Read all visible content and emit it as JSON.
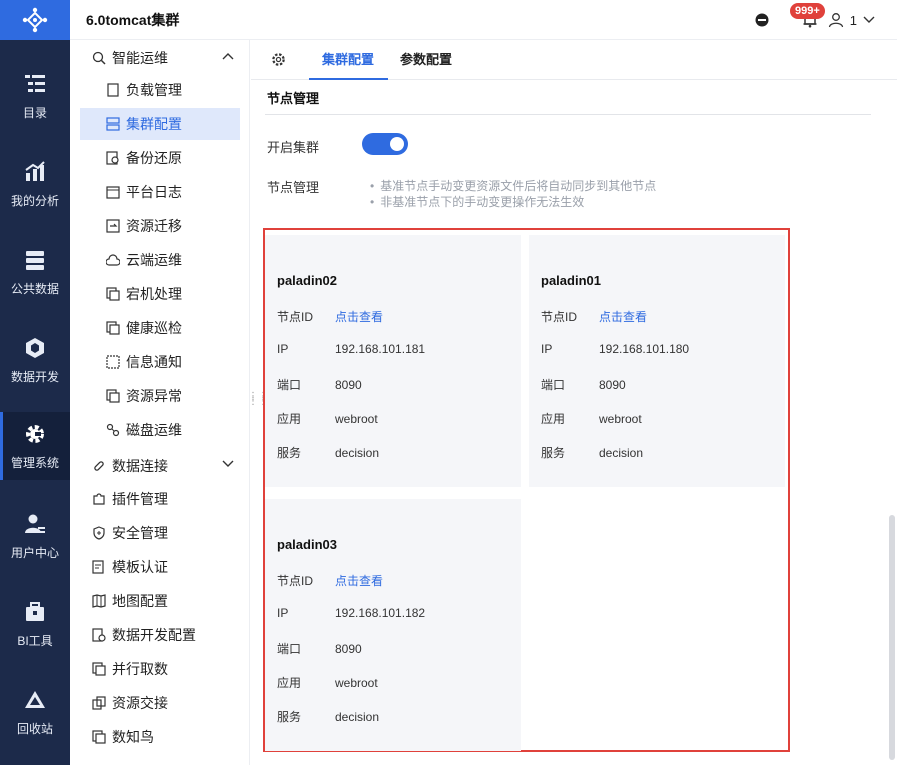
{
  "app": {
    "title": "6.0tomcat集群"
  },
  "header": {
    "notif_count": "999+",
    "user_name": "1"
  },
  "rail": [
    {
      "label": "目录",
      "icon": "catalog-icon"
    },
    {
      "label": "我的分析",
      "icon": "analysis-icon"
    },
    {
      "label": "公共数据",
      "icon": "database-icon"
    },
    {
      "label": "数据开发",
      "icon": "data-dev-icon"
    },
    {
      "label": "管理系统",
      "icon": "gear-icon",
      "active": true
    },
    {
      "label": "用户中心",
      "icon": "user-icon"
    },
    {
      "label": "BI工具",
      "icon": "toolbox-icon"
    },
    {
      "label": "回收站",
      "icon": "recycle-icon"
    }
  ],
  "sidebar": {
    "group_ops": "智能运维",
    "sub_items": [
      "负载管理",
      "集群配置",
      "备份还原",
      "平台日志",
      "资源迁移",
      "云端运维",
      "宕机处理",
      "健康巡检",
      "信息通知",
      "资源异常",
      "磁盘运维"
    ],
    "group_conn": "数据连接",
    "items": [
      "插件管理",
      "安全管理",
      "模板认证",
      "地图配置",
      "数据开发配置",
      "并行取数",
      "资源交接",
      "数知鸟"
    ]
  },
  "tabs": {
    "cluster": "集群配置",
    "params": "参数配置"
  },
  "section": {
    "title": "节点管理",
    "enable_label": "开启集群",
    "enable_value": true,
    "node_label": "节点管理",
    "hint1": "基准节点手动变更资源文件后将自动同步到其他节点",
    "hint2": "非基准节点下的手动变更操作无法生效"
  },
  "field_labels": {
    "id": "节点ID",
    "ip": "IP",
    "port": "端口",
    "app": "应用",
    "service": "服务"
  },
  "nodes": [
    {
      "name": "paladin02",
      "id": "点击查看",
      "ip": "192.168.101.181",
      "port": "8090",
      "app": "webroot",
      "service": "decision"
    },
    {
      "name": "paladin01",
      "id": "点击查看",
      "ip": "192.168.101.180",
      "port": "8090",
      "app": "webroot",
      "service": "decision"
    },
    {
      "name": "paladin03",
      "id": "点击查看",
      "ip": "192.168.101.182",
      "port": "8090",
      "app": "webroot",
      "service": "decision"
    }
  ],
  "colors": {
    "accent": "#2f6be0",
    "rail": "#1c2a4a",
    "highlight": "#e0413b"
  }
}
